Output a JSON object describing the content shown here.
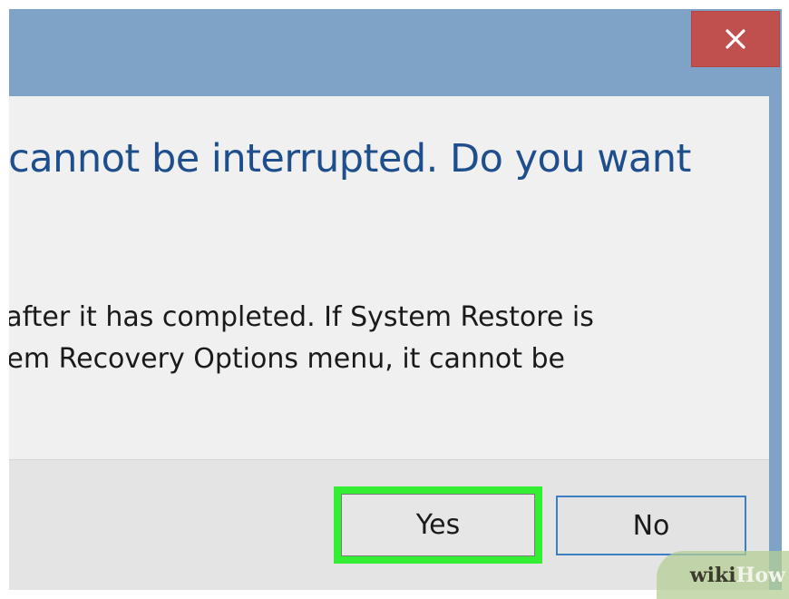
{
  "dialog": {
    "close_icon": "close-x-icon",
    "heading": "e cannot be interrupted. Do you want",
    "body_lines": [
      "il after it has completed. If System Restore is",
      "stem Recovery Options menu, it cannot be"
    ],
    "buttons": {
      "yes": "Yes",
      "no": "No"
    }
  },
  "watermark": {
    "part1": "wiki",
    "part2": "How"
  },
  "colors": {
    "title_bar": "#7ea3c6",
    "close_button": "#c0504d",
    "heading_text": "#1f4e8c",
    "highlight": "#33ee33",
    "no_button_border": "#3c7fc4"
  }
}
